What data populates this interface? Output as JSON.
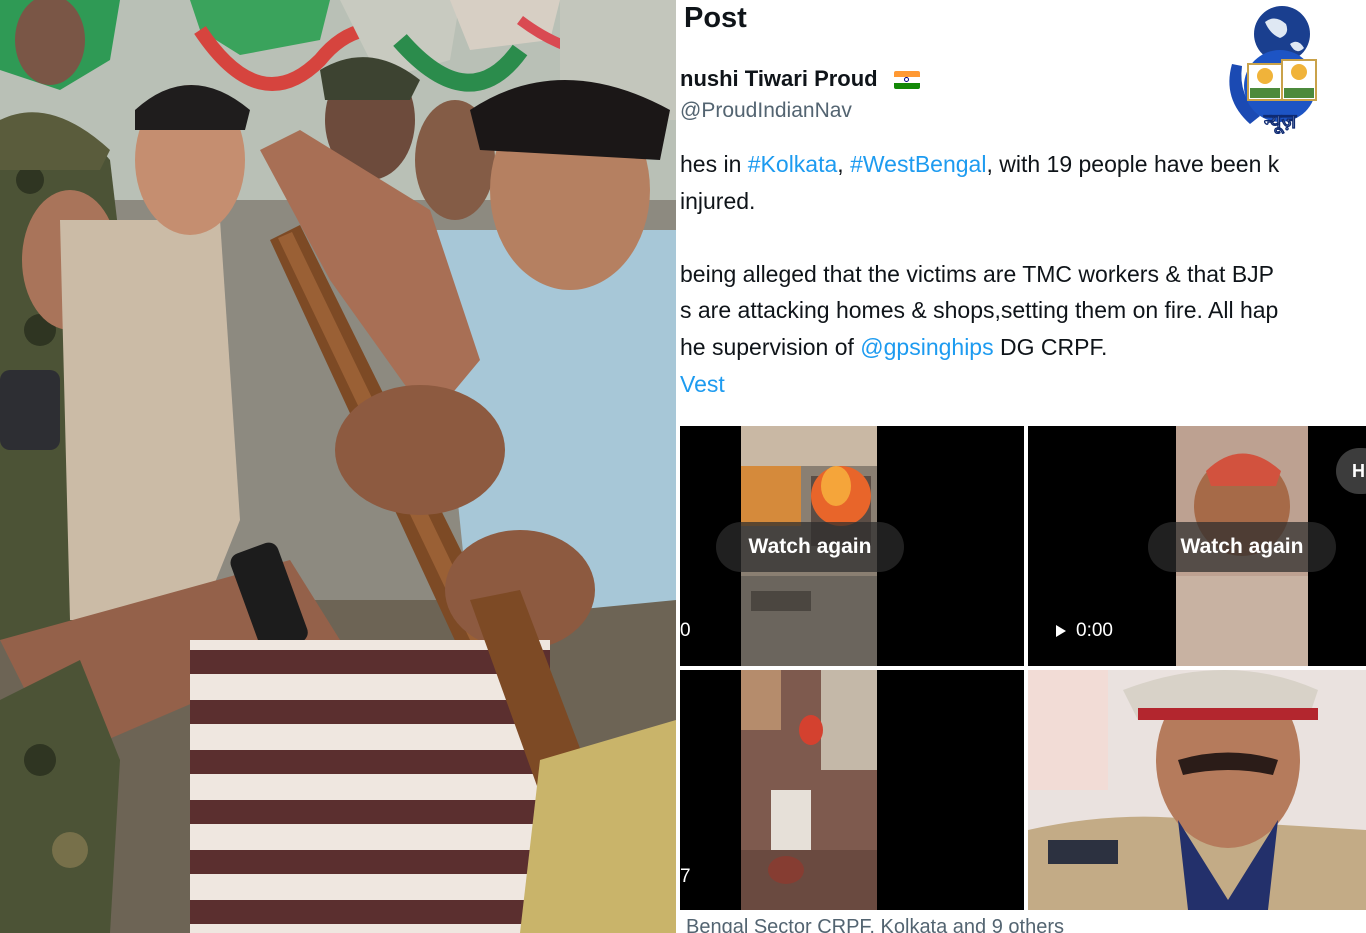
{
  "photo": {
    "description_icon": "crowd-scuffle-photo"
  },
  "tweet": {
    "header_title": "Post",
    "author_name": "nushi Tiwari Proud",
    "handle": "@ProudIndianNav",
    "body": {
      "line1_pre": "hes in ",
      "line1_tag1": "#Kolkata",
      "line1_mid": ", ",
      "line1_tag2": "#WestBengal",
      "line1_post": ", with 19 people have been k",
      "line2": "injured.",
      "line3": "being alleged that the victims are TMC workers & that BJP",
      "line4": "s are attacking homes & shops,setting them on fire. All hap",
      "line5_pre": "he supervision of ",
      "line5_mention": "@gpsinghips",
      "line5_post": " DG CRPF.",
      "line6_tag": "Vest"
    },
    "media": [
      {
        "watch_label": "Watch again",
        "time": "0"
      },
      {
        "watch_label": "Watch again",
        "time": "0:00",
        "badge": "H"
      },
      {
        "time": "7"
      },
      {}
    ],
    "tagged_text": "Bengal Sector CRPF, Kolkata and 9 others"
  },
  "logo": {
    "text": "न्यूज़",
    "icon": "globe-news-logo-icon"
  },
  "colors": {
    "link": "#1d9bf0",
    "secondary_text": "#536471",
    "primary_text": "#0f1419"
  }
}
